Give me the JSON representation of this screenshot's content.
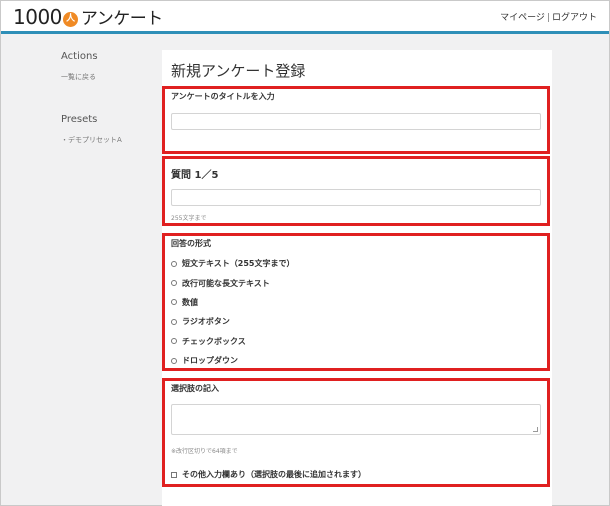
{
  "header": {
    "logo_number": "1000",
    "logo_mark": "人",
    "logo_word": "アンケート",
    "mypage_link": "マイページ",
    "separator": "|",
    "logout_link": "ログアウト",
    "accent_color": "#2e8fb8"
  },
  "sidebar": {
    "actions_heading": "Actions",
    "back_link": "一覧に戻る",
    "presets_heading": "Presets",
    "preset_item": "・デモプリセットA"
  },
  "main": {
    "page_title": "新規アンケート登録",
    "survey_title": {
      "label": "アンケートのタイトルを入力",
      "value": "",
      "placeholder": ""
    },
    "question": {
      "label": "質問 1／5",
      "value": "",
      "placeholder": "",
      "hint": "255文字まで"
    },
    "answer_format": {
      "label": "回答の形式",
      "options": [
        "短文テキスト（255文字まで）",
        "改行可能な長文テキスト",
        "数値",
        "ラジオボタン",
        "チェックボックス",
        "ドロップダウン"
      ]
    },
    "choices": {
      "label": "選択肢の記入",
      "value": "",
      "hint": "※改行区切りで64項まで",
      "other_checkbox_label": "その他入力欄あり（選択肢の最後に追加されます）"
    }
  },
  "highlight_color": "#e02020"
}
